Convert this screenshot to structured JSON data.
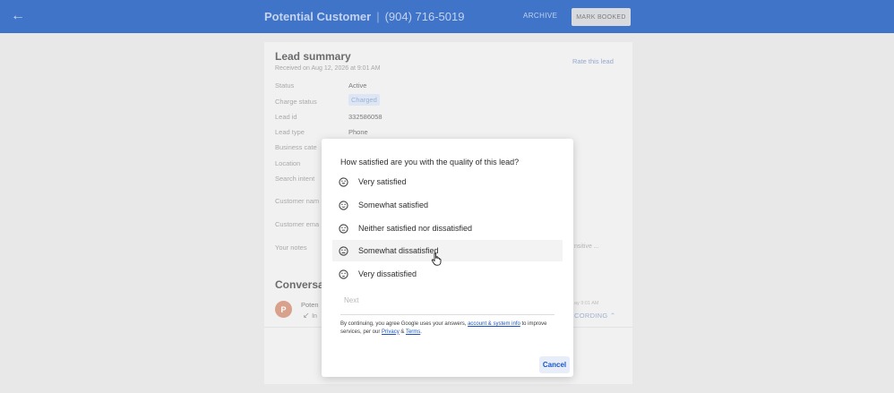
{
  "header": {
    "customer_name": "Potential Customer",
    "separator": "|",
    "phone": "(904) 716-5019",
    "archive_label": "ARCHIVE",
    "mark_booked_label": "MARK BOOKED"
  },
  "lead_summary": {
    "title": "Lead summary",
    "received": "Received on Aug 12, 2026 at 9:01 AM",
    "rate_link": "Rate this lead",
    "rows": [
      {
        "label": "Status",
        "value": "Active"
      },
      {
        "label": "Charge status",
        "value": "Charged"
      },
      {
        "label": "Lead id",
        "value": "332586058"
      },
      {
        "label": "Lead type",
        "value": "Phone"
      },
      {
        "label": "Business cate"
      },
      {
        "label": "Location"
      },
      {
        "label": "Search intent"
      },
      {
        "label": "Customer nam"
      },
      {
        "label": "Customer ema"
      },
      {
        "label": "Your notes"
      }
    ],
    "notes_hint": "nsitive ..."
  },
  "conversation": {
    "title": "Conversati",
    "avatar_initial": "P",
    "name": "Poten",
    "arrow": "↙",
    "direction": "In",
    "time": "ay 9:01 AM",
    "recording": "CORDING"
  },
  "dialog": {
    "question": "How satisfied are you with the quality of this lead?",
    "options": [
      {
        "label": "Very satisfied",
        "icon": "very-satisfied-icon"
      },
      {
        "label": "Somewhat satisfied",
        "icon": "somewhat-satisfied-icon"
      },
      {
        "label": "Neither satisfied nor dissatisfied",
        "icon": "neutral-icon"
      },
      {
        "label": "Somewhat dissatisfied",
        "icon": "somewhat-dissatisfied-icon"
      },
      {
        "label": "Very dissatisfied",
        "icon": "very-dissatisfied-icon"
      }
    ],
    "hovered_option": "Somewhat dissatisfied",
    "next_label": "Next",
    "disclaimer": {
      "prefix": "By continuing, you agree Google uses your answers, ",
      "account_link": "account & system info",
      "middle": " to improve services, per our ",
      "privacy_link": "Privacy",
      "amp": " & ",
      "terms_link": "Terms",
      "suffix": "."
    },
    "cancel_label": "Cancel"
  },
  "colors": {
    "header_bg": "#3f74c9",
    "link_blue": "#1a56c4",
    "page_bg": "#e8e8e8"
  }
}
